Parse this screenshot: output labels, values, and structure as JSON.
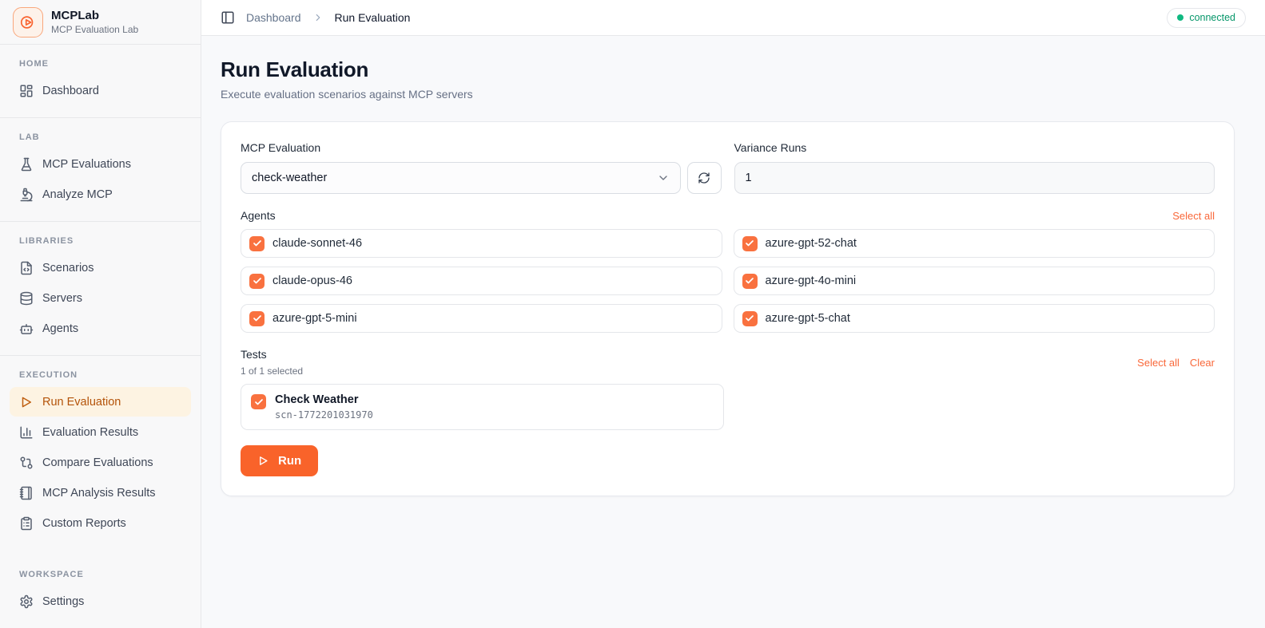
{
  "app": {
    "name": "MCPLab",
    "tagline": "MCP Evaluation Lab"
  },
  "topbar": {
    "breadcrumb": [
      "Dashboard",
      "Run Evaluation"
    ],
    "status": "connected"
  },
  "sidebar": {
    "sections": [
      {
        "label": "HOME",
        "items": [
          {
            "label": "Dashboard",
            "icon": "dashboard-icon"
          }
        ]
      },
      {
        "label": "LAB",
        "items": [
          {
            "label": "MCP Evaluations",
            "icon": "flask-icon"
          },
          {
            "label": "Analyze MCP",
            "icon": "microscope-icon"
          }
        ]
      },
      {
        "label": "LIBRARIES",
        "items": [
          {
            "label": "Scenarios",
            "icon": "file-code-icon"
          },
          {
            "label": "Servers",
            "icon": "database-icon"
          },
          {
            "label": "Agents",
            "icon": "bot-icon"
          }
        ]
      },
      {
        "label": "EXECUTION",
        "items": [
          {
            "label": "Run Evaluation",
            "icon": "play-icon",
            "active": true
          },
          {
            "label": "Evaluation Results",
            "icon": "bar-chart-icon"
          },
          {
            "label": "Compare Evaluations",
            "icon": "git-compare-icon"
          },
          {
            "label": "MCP Analysis Results",
            "icon": "notebook-icon"
          },
          {
            "label": "Custom Reports",
            "icon": "clipboard-list-icon"
          }
        ]
      },
      {
        "label": "WORKSPACE",
        "items": [
          {
            "label": "Settings",
            "icon": "gear-icon"
          }
        ]
      }
    ]
  },
  "page": {
    "title": "Run Evaluation",
    "subtitle": "Execute evaluation scenarios against MCP servers"
  },
  "form": {
    "mcp_evaluation": {
      "label": "MCP Evaluation",
      "value": "check-weather"
    },
    "variance_runs": {
      "label": "Variance Runs",
      "value": "1"
    },
    "agents": {
      "label": "Agents",
      "select_all": "Select all",
      "items": [
        "claude-sonnet-46",
        "azure-gpt-52-chat",
        "claude-opus-46",
        "azure-gpt-4o-mini",
        "azure-gpt-5-mini",
        "azure-gpt-5-chat"
      ],
      "all_checked": true
    },
    "tests": {
      "label": "Tests",
      "selected_text": "1 of 1 selected",
      "select_all": "Select all",
      "clear": "Clear",
      "items": [
        {
          "title": "Check Weather",
          "id": "scn-1772201031970",
          "checked": true
        }
      ]
    },
    "run_label": "Run"
  },
  "colors": {
    "accent": "#f9632a",
    "checkbox": "#f9713f",
    "link": "#f9683a",
    "connected_text": "#059669",
    "connected_dot": "#10b981",
    "active_nav_bg": "#fdf3e2",
    "active_nav_text": "#b45309"
  }
}
